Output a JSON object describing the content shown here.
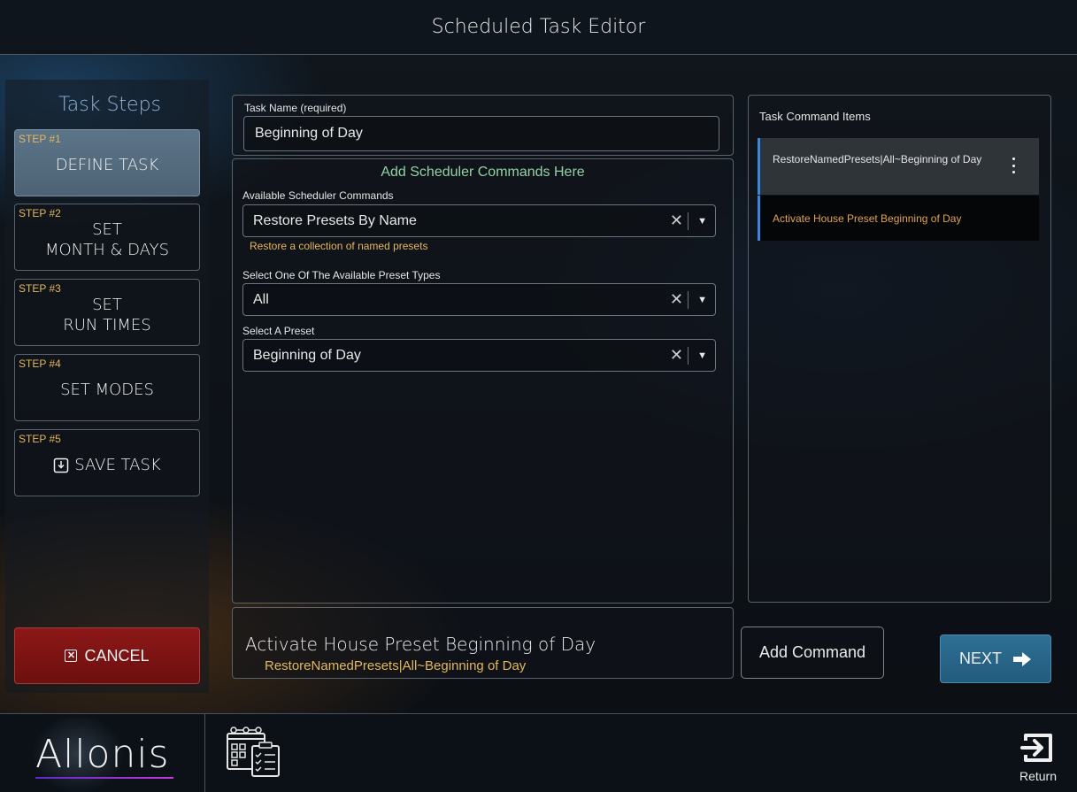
{
  "header": {
    "title": "Scheduled Task Editor"
  },
  "sidebar": {
    "heading": "Task Steps",
    "steps": [
      {
        "num": "STEP #1",
        "label": "DEFINE TASK"
      },
      {
        "num": "STEP #2",
        "label": "SET\nMONTH & DAYS"
      },
      {
        "num": "STEP #3",
        "label": "SET\nRUN TIMES"
      },
      {
        "num": "STEP #4",
        "label": "SET MODES"
      },
      {
        "num": "STEP #5",
        "label": "SAVE TASK"
      }
    ],
    "cancel_label": "CANCEL"
  },
  "task_name": {
    "label": "Task Name (required)",
    "value": "Beginning of Day"
  },
  "commands": {
    "section_title": "Add Scheduler Commands Here",
    "available": {
      "label": "Available Scheduler Commands",
      "value": "Restore Presets By Name",
      "helper": "Restore a collection of named presets"
    },
    "preset_type": {
      "label": "Select One Of The Available Preset Types",
      "value": "All"
    },
    "preset": {
      "label": "Select A Preset",
      "value": "Beginning of Day"
    },
    "clear_glyph": "✕",
    "caret_glyph": "▼"
  },
  "summary": {
    "command": "Activate House Preset Beginning of Day",
    "code": "RestoreNamedPresets|All~Beginning of Day"
  },
  "command_items": {
    "label": "Task Command Items",
    "items": [
      {
        "text": "RestoreNamedPresets|All~Beginning of Day"
      },
      {
        "text": "Activate House Preset Beginning of Day"
      }
    ]
  },
  "buttons": {
    "add_command": "Add Command",
    "next": "NEXT"
  },
  "footer": {
    "logo": "Allonis",
    "return_label": "Return"
  },
  "colors": {
    "accent_gold": "#e2b85a",
    "accent_green": "#8ed3a4",
    "cancel_red": "#8c1818",
    "next_blue": "#2d6f95",
    "item_border": "#3f86d6"
  }
}
